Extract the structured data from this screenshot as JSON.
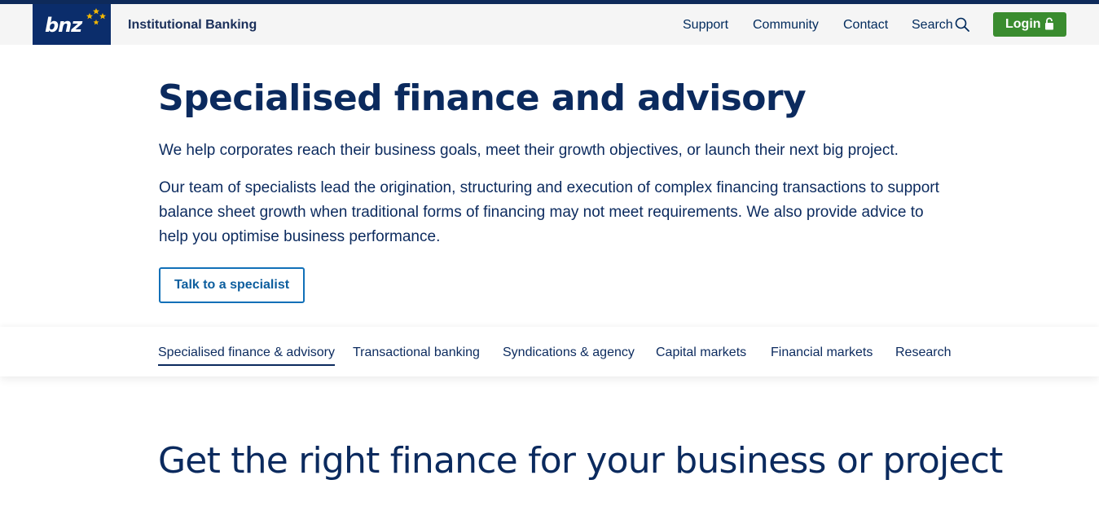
{
  "brand": {
    "logo_text": "bnz",
    "site_title": "Institutional Banking"
  },
  "header": {
    "nav": [
      "Support",
      "Community",
      "Contact",
      "Search"
    ],
    "login_label": "Login"
  },
  "hero": {
    "title": "Specialised finance and advisory",
    "paragraph1": "We help corporates reach their business goals, meet their growth objectives, or launch their next big project.",
    "paragraph2": "Our team of specialists lead the origination, structuring and execution of complex financing transactions to support balance sheet growth when traditional forms of financing may not meet requirements. We also provide advice to help you optimise business performance.",
    "cta_label": "Talk to a specialist"
  },
  "subnav": {
    "items": [
      "Specialised finance & advisory",
      "Transactional banking",
      "Syndications & agency",
      "Capital markets",
      "Financial markets",
      "Research"
    ],
    "active": "Specialised finance & advisory"
  },
  "section": {
    "title": "Get the right finance for your business or project"
  },
  "colors": {
    "primary": "#0b2a5e",
    "logo_bg": "#0b2d6b",
    "login_green": "#3a8c2f",
    "link_blue": "#1170b8",
    "star_gold": "#f2b705"
  },
  "icons": [
    "bnz-stars-icon",
    "search-icon",
    "lock-icon"
  ]
}
